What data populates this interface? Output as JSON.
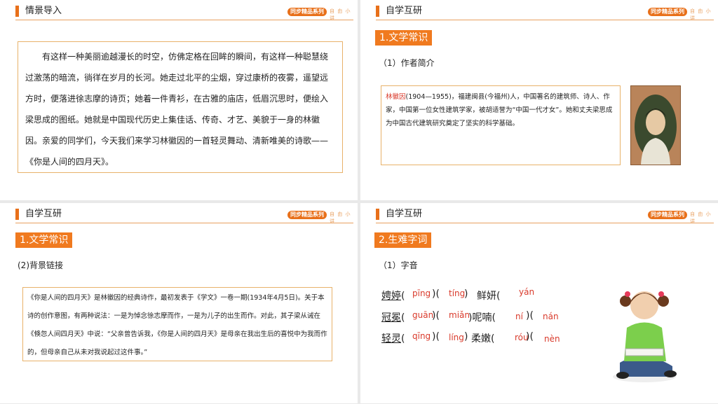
{
  "badge": "同步精品系列",
  "badge_tail": "自 由 小 讲",
  "slide1": {
    "heading": "情景导入",
    "paragraph": "有这样一种美丽逾越漫长的时空，仿佛定格在回眸的瞬间，有这样一种聪慧绕过激荡的暗流，徜徉在岁月的长河。她走过北平的尘烟，穿过康桥的夜雾，遥望远方时，便落进徐志摩的诗页；她着一件青衫，在古雅的庙店，低眉沉思时，便绘入梁思成的图纸。她就是中国现代历史上集佳话、传奇、才艺、美貌于一身的林徽因。亲爱的同学们，今天我们来学习林徽因的一首轻灵舞动、清新唯美的诗歌——《你是人间的四月天》。"
  },
  "slide2": {
    "heading": "自学互研",
    "section": "1.文学常识",
    "subheading": "（1）作者简介",
    "name": "林徽因",
    "bio": "(1904—1955)，福建闽县(今福州)人，中国著名的建筑师、诗人、作家，中国第一位女性建筑学家，被胡适誉为“中国一代才女”。她和丈夫梁思成为中国古代建筑研究奠定了坚实的科学基础。"
  },
  "slide3": {
    "heading": "自学互研",
    "section": "1.文学常识",
    "subheading": "(2)背景链接",
    "paragraph": "《你是人间的四月天》是林徽因的经典诗作，最初发表于《学文》一卷一期(1934年4月5日)。关于本诗的创作意图，有两种说法：一是为悼念徐志摩而作，一是为儿子的出生而作。对此，其子梁从诫在《倏忽人间四月天》中说：“父亲曾告诉我，《你是人间的四月天》是母亲在我出生后的喜悦中为我而作的，但母亲自己从未对我说起过这件事。”"
  },
  "slide4": {
    "heading": "自学互研",
    "section": "2.生难字词",
    "subheading": "（1）字音",
    "rows": [
      {
        "w1": "娉婷",
        "p1a": "pīng",
        "p1b": "tíng",
        "w2": "鲜妍",
        "p2b": "yán"
      },
      {
        "w1": "冠冕",
        "p1a": "guān",
        "p1b": "miǎn",
        "w2": "呢喃",
        "p2a": "ní",
        "p2b": "nán"
      },
      {
        "w1": "轻灵",
        "p1a": "qīng",
        "p1b": "líng",
        "w2": "柔嫩",
        "p2a": "róu",
        "p2b": "nèn"
      }
    ]
  }
}
